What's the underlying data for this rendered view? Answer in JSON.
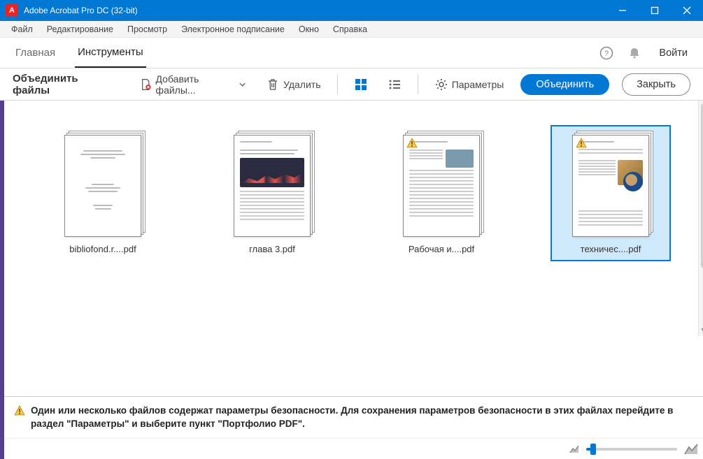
{
  "titlebar": {
    "title": "Adobe Acrobat Pro DC (32-bit)"
  },
  "menubar": [
    "Файл",
    "Редактирование",
    "Просмотр",
    "Электронное подписание",
    "Окно",
    "Справка"
  ],
  "tabs": {
    "home": "Главная",
    "tools": "Инструменты",
    "login": "Войти"
  },
  "toolbar": {
    "title": "Объединить файлы",
    "add_files": "Добавить файлы...",
    "delete": "Удалить",
    "options": "Параметры",
    "combine": "Объединить",
    "close": "Закрыть"
  },
  "files": [
    {
      "name": "bibliofond.r....pdf",
      "warn": false,
      "style": "text"
    },
    {
      "name": "глава 3.pdf",
      "warn": false,
      "style": "chart"
    },
    {
      "name": "Рабочая и....pdf",
      "warn": true,
      "style": "doc"
    },
    {
      "name": "техничес....pdf",
      "warn": true,
      "style": "image",
      "selected": true
    }
  ],
  "warning": "Один или несколько файлов содержат параметры безопасности. Для сохранения параметров безопасности в этих файлах перейдите в раздел \"Параметры\" и выберите пункт \"Портфолио PDF\".",
  "sidebar_icons": [
    "create-pdf",
    "export-pdf",
    "edit-pdf",
    "organize",
    "sign",
    "redact",
    "protect",
    "comment",
    "print",
    "shield"
  ]
}
